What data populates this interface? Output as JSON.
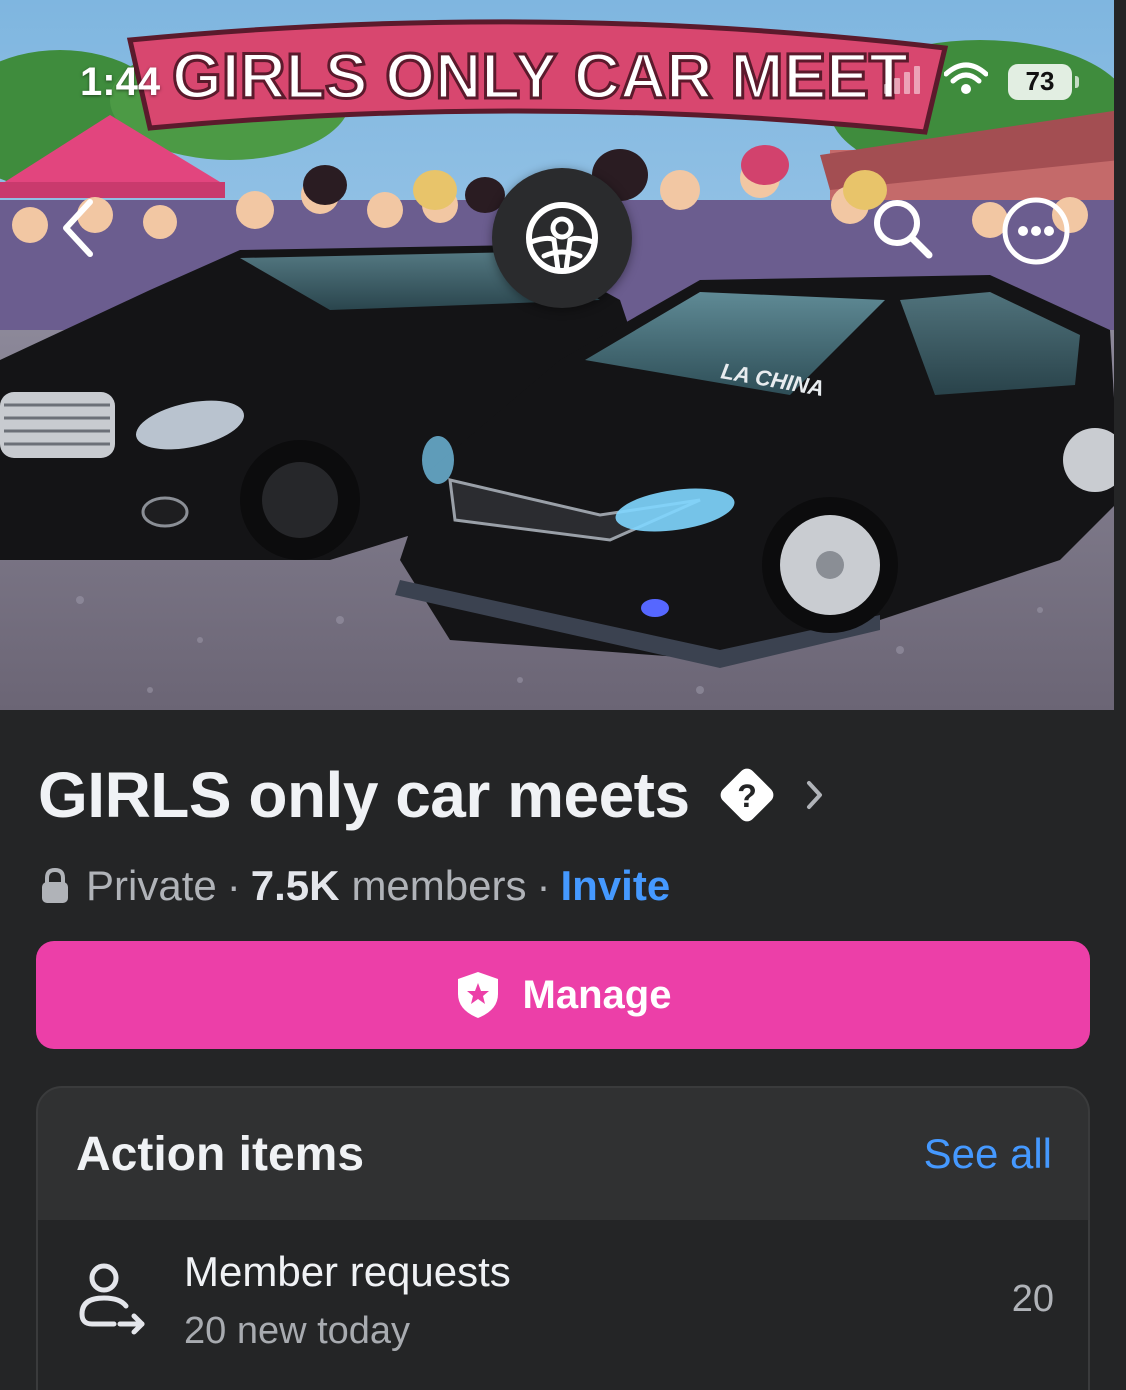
{
  "status_bar": {
    "time": "1:44",
    "battery": "73"
  },
  "cover": {
    "banner_text": "GIRLS ONLY CAR MEET",
    "windshield_text": "LA CHINA"
  },
  "group": {
    "name": "GIRLS only car meets",
    "privacy": "Private",
    "member_count": "7.5K",
    "members_label": "members",
    "invite_label": "Invite"
  },
  "manage_label": "Manage",
  "action_items": {
    "title": "Action items",
    "see_all_label": "See all",
    "items": [
      {
        "title": "Member requests",
        "subtitle": "20 new today",
        "count": "20"
      }
    ]
  },
  "colors": {
    "accent_pink": "#ec3fa8",
    "link_blue": "#4599ff",
    "background": "#242526"
  }
}
